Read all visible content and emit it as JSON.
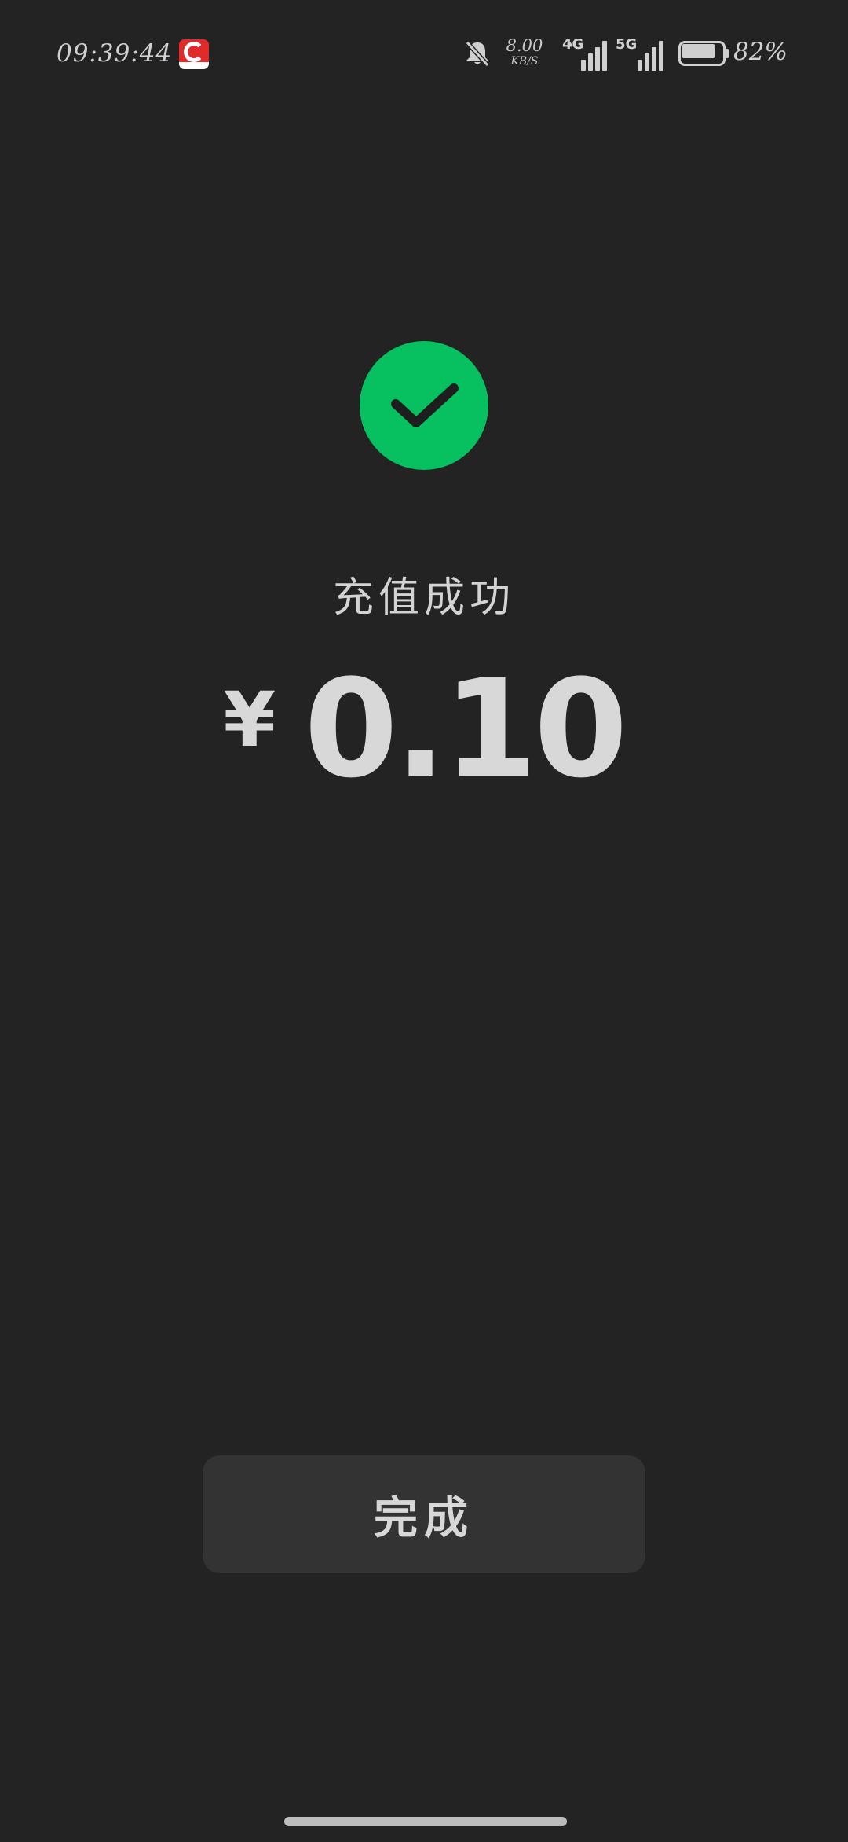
{
  "status_bar": {
    "time": "09:39:44",
    "app_icon": "red-c-app-icon",
    "mute_icon": "bell-off-icon",
    "net_speed_value": "8.00",
    "net_speed_unit": "KB/S",
    "signal_1_label": "4G",
    "signal_2_label": "5G",
    "battery_level": 0.82,
    "battery_text": "82%"
  },
  "result": {
    "icon": "checkmark-circle-icon",
    "status_color": "#07c160",
    "title": "充值成功",
    "currency_symbol": "¥",
    "amount": "0.10"
  },
  "actions": {
    "done_label": "完成"
  }
}
